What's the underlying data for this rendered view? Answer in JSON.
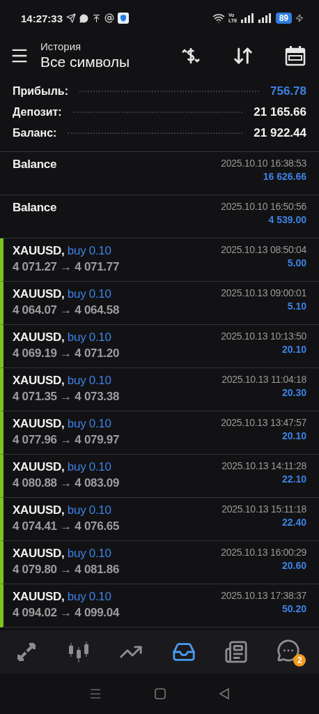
{
  "status_bar": {
    "time": "14:27:33",
    "network_label_top": "Vo",
    "network_label_bottom": "LTE",
    "battery": "89"
  },
  "header": {
    "subtitle": "История",
    "title": "Все символы"
  },
  "summary": [
    {
      "label": "Прибыль:",
      "value": "756.78",
      "highlighted": true
    },
    {
      "label": "Депозит:",
      "value": "21 165.66",
      "highlighted": false
    },
    {
      "label": "Баланс:",
      "value": "21 922.44",
      "highlighted": false
    }
  ],
  "rows": [
    {
      "kind": "balance",
      "title": "Balance",
      "time": "2025.10.10 16:38:53",
      "amount": "16 626.66"
    },
    {
      "kind": "balance",
      "title": "Balance",
      "time": "2025.10.10 16:50:56",
      "amount": "4 539.00"
    },
    {
      "kind": "trade",
      "symbol": "XAUUSD,",
      "action": "buy 0.10",
      "prices": "4 071.27 → 4 071.77",
      "time": "2025.10.13 08:50:04",
      "amount": "5.00"
    },
    {
      "kind": "trade",
      "symbol": "XAUUSD,",
      "action": "buy 0.10",
      "prices": "4 064.07 → 4 064.58",
      "time": "2025.10.13 09:00:01",
      "amount": "5.10"
    },
    {
      "kind": "trade",
      "symbol": "XAUUSD,",
      "action": "buy 0.10",
      "prices": "4 069.19 → 4 071.20",
      "time": "2025.10.13 10:13:50",
      "amount": "20.10"
    },
    {
      "kind": "trade",
      "symbol": "XAUUSD,",
      "action": "buy 0.10",
      "prices": "4 071.35 → 4 073.38",
      "time": "2025.10.13 11:04:18",
      "amount": "20.30"
    },
    {
      "kind": "trade",
      "symbol": "XAUUSD,",
      "action": "buy 0.10",
      "prices": "4 077.96 → 4 079.97",
      "time": "2025.10.13 13:47:57",
      "amount": "20.10"
    },
    {
      "kind": "trade",
      "symbol": "XAUUSD,",
      "action": "buy 0.10",
      "prices": "4 080.88 → 4 083.09",
      "time": "2025.10.13 14:11:28",
      "amount": "22.10"
    },
    {
      "kind": "trade",
      "symbol": "XAUUSD,",
      "action": "buy 0.10",
      "prices": "4 074.41 → 4 076.65",
      "time": "2025.10.13 15:11:18",
      "amount": "22.40"
    },
    {
      "kind": "trade",
      "symbol": "XAUUSD,",
      "action": "buy 0.10",
      "prices": "4 079.80 → 4 081.86",
      "time": "2025.10.13 16:00:29",
      "amount": "20.60"
    },
    {
      "kind": "trade",
      "symbol": "XAUUSD,",
      "action": "buy 0.10",
      "prices": "4 094.02 → 4 099.04",
      "time": "2025.10.13 17:38:37",
      "amount": "50.20"
    }
  ],
  "bottom_nav": [
    {
      "kind": "quotes",
      "selected": false
    },
    {
      "kind": "chart",
      "selected": false
    },
    {
      "kind": "trade",
      "selected": false
    },
    {
      "kind": "history",
      "selected": true
    },
    {
      "kind": "news",
      "selected": false
    },
    {
      "kind": "chat",
      "selected": false,
      "badge": "2"
    }
  ]
}
